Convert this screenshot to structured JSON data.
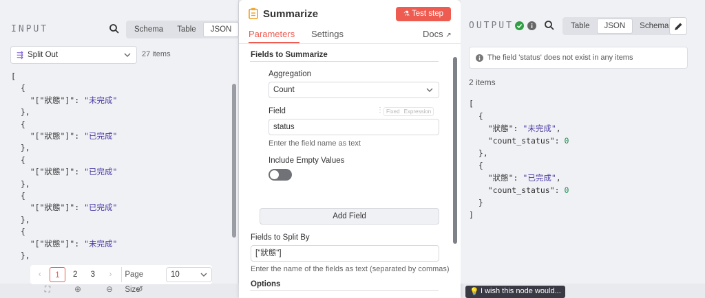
{
  "input": {
    "title": "INPUT",
    "view_tabs": [
      "Schema",
      "Table",
      "JSON"
    ],
    "active_tab": "JSON",
    "node_select": "Split Out",
    "item_count": "27 items",
    "json_lines": [
      [
        "[",
        ""
      ],
      [
        "  {",
        ""
      ],
      [
        "    \"[\"狀態\"]\": ",
        "\"未完成\""
      ],
      [
        "  },",
        ""
      ],
      [
        "  {",
        ""
      ],
      [
        "    \"[\"狀態\"]\": ",
        "\"已完成\""
      ],
      [
        "  },",
        ""
      ],
      [
        "  {",
        ""
      ],
      [
        "    \"[\"狀態\"]\": ",
        "\"已完成\""
      ],
      [
        "  },",
        ""
      ],
      [
        "  {",
        ""
      ],
      [
        "    \"[\"狀態\"]\": ",
        "\"已完成\""
      ],
      [
        "  },",
        ""
      ],
      [
        "  {",
        ""
      ],
      [
        "    \"[\"狀態\"]\": ",
        "\"未完成\""
      ],
      [
        "  },",
        ""
      ]
    ],
    "pager": {
      "prev": "‹",
      "pages": [
        "1",
        "2",
        "3"
      ],
      "active_page": "1",
      "next": "›",
      "page_size_label": "Page Size",
      "page_size_value": "10"
    }
  },
  "node": {
    "title": "Summarize",
    "test_button": "Test step",
    "tabs": [
      "Parameters",
      "Settings"
    ],
    "active_tab": "Parameters",
    "docs_label": "Docs",
    "fields_to_summarize_header": "Fields to Summarize",
    "aggregation_label": "Aggregation",
    "aggregation_value": "Count",
    "field_label": "Field",
    "field_mode_fixed": "Fixed",
    "field_mode_expression": "Expression",
    "field_value": "status",
    "field_hint": "Enter the field name as text",
    "include_empty_label": "Include Empty Values",
    "include_empty_value": false,
    "add_field_button": "Add Field",
    "split_by_label": "Fields to Split By",
    "split_by_value": "[\"狀態\"]",
    "split_by_hint": "Enter the name of the fields as text (separated by commas)",
    "options_header": "Options"
  },
  "output": {
    "title": "OUTPUT",
    "view_tabs": [
      "Table",
      "JSON",
      "Schema"
    ],
    "active_tab": "JSON",
    "notice": "The field 'status' does not exist in any items",
    "item_count": "2 items",
    "json_lines": [
      [
        "[",
        "",
        ""
      ],
      [
        "  {",
        "",
        ""
      ],
      [
        "    \"狀態\": ",
        "\"未完成\"",
        ","
      ],
      [
        "    \"count_status\": ",
        "0",
        ""
      ],
      [
        "  },",
        "",
        ""
      ],
      [
        "  {",
        "",
        ""
      ],
      [
        "    \"狀態\": ",
        "\"已完成\"",
        ","
      ],
      [
        "    \"count_status\": ",
        "0",
        ""
      ],
      [
        "  }",
        "",
        ""
      ],
      [
        "]",
        "",
        ""
      ]
    ]
  },
  "footer": {
    "wish_text": "I wish this node would..."
  },
  "colors": {
    "accent": "#ee5b50",
    "success": "#2f9e44",
    "json_string": "#4b3aa3",
    "json_number": "#1f8b4c"
  }
}
